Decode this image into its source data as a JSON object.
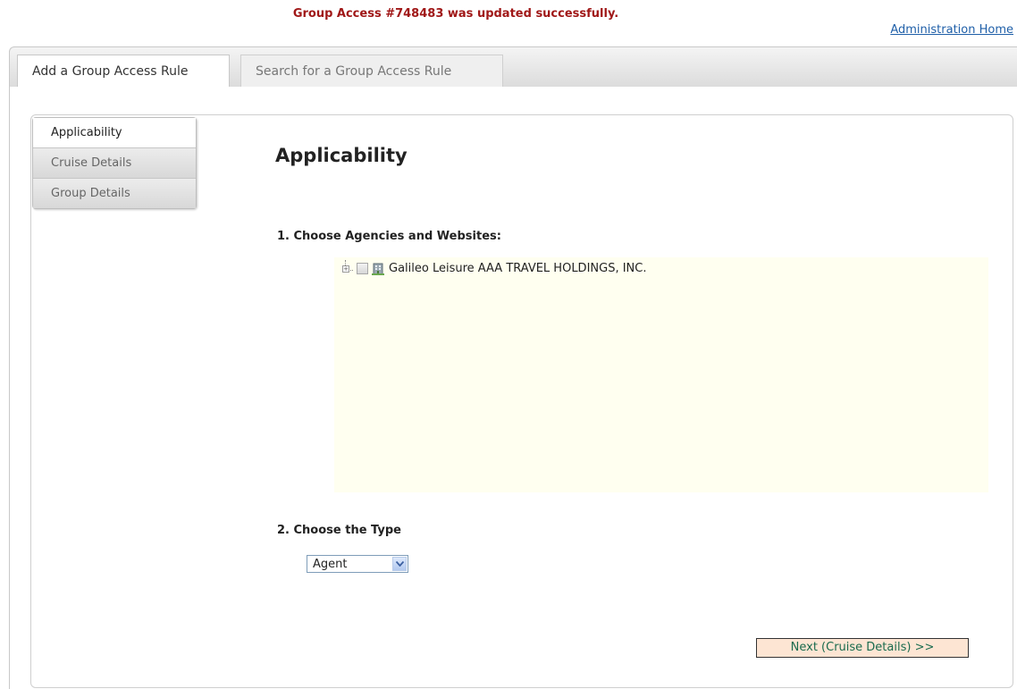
{
  "status_message": "Group Access #748483 was updated successfully.",
  "admin_home_link": "Administration Home",
  "tabs": [
    {
      "label": "Add a Group Access Rule",
      "active": true
    },
    {
      "label": "Search for a Group Access Rule",
      "active": false
    }
  ],
  "sidenav": {
    "items": [
      {
        "label": "Applicability",
        "active": true
      },
      {
        "label": "Cruise Details",
        "active": false
      },
      {
        "label": "Group Details",
        "active": false
      }
    ]
  },
  "main": {
    "heading": "Applicability",
    "section1_label": "1. Choose Agencies and Websites:",
    "tree": {
      "items": [
        {
          "label": "Galileo Leisure AAA TRAVEL HOLDINGS, INC.",
          "checked": false,
          "icon": "building-icon"
        }
      ]
    },
    "section2_label": "2. Choose the Type",
    "type_select": {
      "value": "Agent"
    },
    "next_button_label": "Next (Cruise Details) >>"
  },
  "colors": {
    "status": "#a01818",
    "link": "#1f5fa8",
    "tree_background": "#fffff0",
    "next_button_background": "#fde5d3",
    "next_button_text": "#1a6b4e"
  }
}
